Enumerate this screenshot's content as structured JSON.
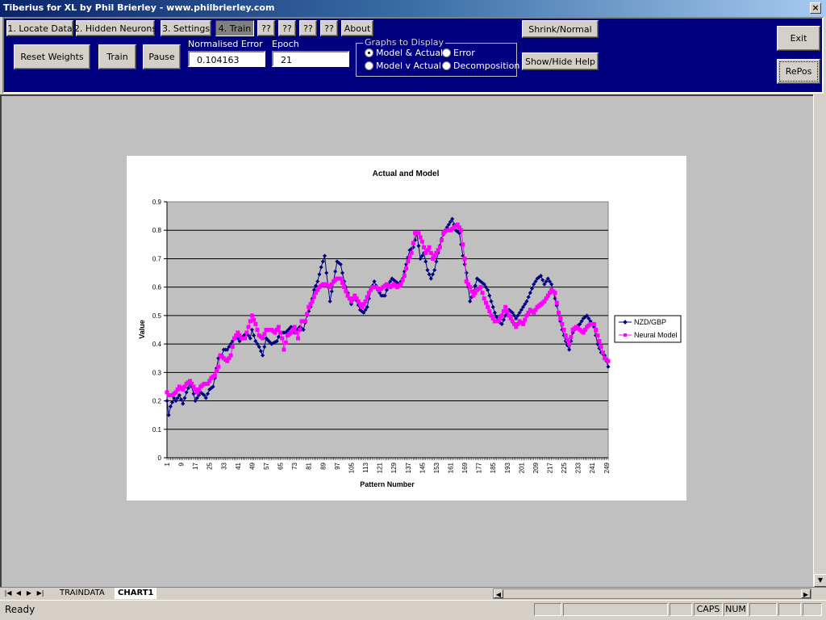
{
  "window": {
    "title": "Tiberius for XL by Phil Brierley - www.philbrierley.com",
    "close_icon": "×"
  },
  "tabs": [
    {
      "label": "1. Locate Data"
    },
    {
      "label": "2. Hidden Neurons"
    },
    {
      "label": "3. Settings"
    },
    {
      "label": "4. Train",
      "active": true
    },
    {
      "label": "??"
    },
    {
      "label": "??"
    },
    {
      "label": "??"
    },
    {
      "label": "??"
    },
    {
      "label": "About"
    }
  ],
  "controls": {
    "reset_weights": "Reset Weights",
    "train": "Train",
    "pause": "Pause",
    "normalised_error_label": "Normalised Error",
    "normalised_error_value": "0.104163",
    "epoch_label": "Epoch",
    "epoch_value": "21",
    "shrink_normal": "Shrink/Normal",
    "show_hide_help": "Show/Hide Help",
    "exit": "Exit",
    "repos": "RePos"
  },
  "graphs_to_display": {
    "legend": "Graphs to Display",
    "options": [
      {
        "label": "Model & Actual",
        "selected": true
      },
      {
        "label": "Error",
        "selected": false
      },
      {
        "label": "Model v Actual",
        "selected": false
      },
      {
        "label": "Decomposition",
        "selected": false
      }
    ]
  },
  "sheet_tabs": [
    {
      "label": "TRAINDATA",
      "active": false
    },
    {
      "label": "CHART1",
      "active": true
    }
  ],
  "status_bar": {
    "status": "Ready",
    "indicators": [
      "CAPS",
      "NUM"
    ]
  },
  "chart_data": {
    "type": "line",
    "title": "Actual and Model",
    "xlabel": "Pattern Number",
    "ylabel": "Value",
    "ylim": [
      0,
      0.9
    ],
    "yticks": [
      "0",
      "0.1",
      "0.2",
      "0.3",
      "0.4",
      "0.5",
      "0.6",
      "0.7",
      "0.8",
      "0.9"
    ],
    "xlim": [
      1,
      250
    ],
    "xticks": [
      "1",
      "9",
      "17",
      "25",
      "33",
      "41",
      "49",
      "57",
      "65",
      "73",
      "81",
      "89",
      "97",
      "105",
      "113",
      "121",
      "129",
      "137",
      "145",
      "153",
      "161",
      "169",
      "177",
      "185",
      "193",
      "201",
      "209",
      "217",
      "225",
      "233",
      "241",
      "249"
    ],
    "grid": true,
    "legend_position": "right",
    "series": [
      {
        "name": "NZD/GBP",
        "color": "#000080",
        "marker": "diamond",
        "points": [
          [
            1,
            0.2
          ],
          [
            2,
            0.15
          ],
          [
            3,
            0.18
          ],
          [
            5,
            0.21
          ],
          [
            6,
            0.2
          ],
          [
            8,
            0.22
          ],
          [
            10,
            0.19
          ],
          [
            12,
            0.23
          ],
          [
            14,
            0.26
          ],
          [
            15,
            0.25
          ],
          [
            17,
            0.2
          ],
          [
            19,
            0.22
          ],
          [
            20,
            0.23
          ],
          [
            22,
            0.22
          ],
          [
            23,
            0.21
          ],
          [
            25,
            0.24
          ],
          [
            27,
            0.25
          ],
          [
            28,
            0.28
          ],
          [
            30,
            0.35
          ],
          [
            32,
            0.36
          ],
          [
            33,
            0.38
          ],
          [
            35,
            0.38
          ],
          [
            37,
            0.4
          ],
          [
            40,
            0.43
          ],
          [
            42,
            0.41
          ],
          [
            43,
            0.42
          ],
          [
            46,
            0.44
          ],
          [
            48,
            0.42
          ],
          [
            49,
            0.45
          ],
          [
            51,
            0.41
          ],
          [
            53,
            0.39
          ],
          [
            55,
            0.36
          ],
          [
            57,
            0.42
          ],
          [
            60,
            0.4
          ],
          [
            63,
            0.41
          ],
          [
            65,
            0.44
          ],
          [
            68,
            0.44
          ],
          [
            71,
            0.46
          ],
          [
            73,
            0.44
          ],
          [
            76,
            0.46
          ],
          [
            78,
            0.45
          ],
          [
            80,
            0.5
          ],
          [
            82,
            0.53
          ],
          [
            84,
            0.59
          ],
          [
            86,
            0.62
          ],
          [
            88,
            0.67
          ],
          [
            90,
            0.71
          ],
          [
            91,
            0.65
          ],
          [
            93,
            0.55
          ],
          [
            95,
            0.62
          ],
          [
            97,
            0.69
          ],
          [
            99,
            0.68
          ],
          [
            101,
            0.62
          ],
          [
            103,
            0.58
          ],
          [
            105,
            0.54
          ],
          [
            107,
            0.57
          ],
          [
            110,
            0.52
          ],
          [
            112,
            0.51
          ],
          [
            114,
            0.53
          ],
          [
            116,
            0.59
          ],
          [
            118,
            0.62
          ],
          [
            120,
            0.59
          ],
          [
            122,
            0.57
          ],
          [
            124,
            0.57
          ],
          [
            126,
            0.61
          ],
          [
            128,
            0.63
          ],
          [
            130,
            0.62
          ],
          [
            132,
            0.61
          ],
          [
            134,
            0.63
          ],
          [
            136,
            0.68
          ],
          [
            138,
            0.73
          ],
          [
            140,
            0.74
          ],
          [
            142,
            0.79
          ],
          [
            144,
            0.7
          ],
          [
            146,
            0.72
          ],
          [
            148,
            0.66
          ],
          [
            150,
            0.63
          ],
          [
            152,
            0.66
          ],
          [
            154,
            0.72
          ],
          [
            156,
            0.77
          ],
          [
            158,
            0.8
          ],
          [
            160,
            0.82
          ],
          [
            162,
            0.84
          ],
          [
            164,
            0.8
          ],
          [
            166,
            0.79
          ],
          [
            168,
            0.71
          ],
          [
            170,
            0.65
          ],
          [
            172,
            0.55
          ],
          [
            174,
            0.58
          ],
          [
            176,
            0.63
          ],
          [
            178,
            0.62
          ],
          [
            180,
            0.61
          ],
          [
            182,
            0.59
          ],
          [
            184,
            0.55
          ],
          [
            186,
            0.51
          ],
          [
            188,
            0.48
          ],
          [
            190,
            0.47
          ],
          [
            192,
            0.5
          ],
          [
            194,
            0.52
          ],
          [
            196,
            0.51
          ],
          [
            198,
            0.49
          ],
          [
            200,
            0.51
          ],
          [
            202,
            0.53
          ],
          [
            204,
            0.55
          ],
          [
            206,
            0.58
          ],
          [
            208,
            0.61
          ],
          [
            210,
            0.63
          ],
          [
            212,
            0.64
          ],
          [
            214,
            0.61
          ],
          [
            216,
            0.63
          ],
          [
            218,
            0.61
          ],
          [
            220,
            0.56
          ],
          [
            222,
            0.51
          ],
          [
            224,
            0.45
          ],
          [
            226,
            0.41
          ],
          [
            228,
            0.38
          ],
          [
            230,
            0.44
          ],
          [
            232,
            0.46
          ],
          [
            234,
            0.47
          ],
          [
            236,
            0.49
          ],
          [
            238,
            0.5
          ],
          [
            240,
            0.48
          ],
          [
            242,
            0.46
          ],
          [
            244,
            0.4
          ],
          [
            246,
            0.37
          ],
          [
            248,
            0.36
          ],
          [
            250,
            0.32
          ]
        ]
      },
      {
        "name": "Neural Model",
        "color": "#ff00ff",
        "marker": "square",
        "points": [
          [
            1,
            0.23
          ],
          [
            2,
            0.22
          ],
          [
            4,
            0.22
          ],
          [
            6,
            0.23
          ],
          [
            8,
            0.25
          ],
          [
            10,
            0.24
          ],
          [
            12,
            0.26
          ],
          [
            14,
            0.27
          ],
          [
            16,
            0.25
          ],
          [
            18,
            0.23
          ],
          [
            20,
            0.25
          ],
          [
            22,
            0.26
          ],
          [
            24,
            0.26
          ],
          [
            26,
            0.28
          ],
          [
            28,
            0.29
          ],
          [
            30,
            0.32
          ],
          [
            31,
            0.36
          ],
          [
            33,
            0.35
          ],
          [
            35,
            0.34
          ],
          [
            37,
            0.36
          ],
          [
            39,
            0.42
          ],
          [
            41,
            0.44
          ],
          [
            43,
            0.42
          ],
          [
            45,
            0.42
          ],
          [
            47,
            0.46
          ],
          [
            49,
            0.5
          ],
          [
            51,
            0.47
          ],
          [
            53,
            0.43
          ],
          [
            55,
            0.42
          ],
          [
            57,
            0.45
          ],
          [
            60,
            0.45
          ],
          [
            62,
            0.44
          ],
          [
            64,
            0.46
          ],
          [
            66,
            0.42
          ],
          [
            67,
            0.38
          ],
          [
            69,
            0.43
          ],
          [
            71,
            0.44
          ],
          [
            73,
            0.46
          ],
          [
            75,
            0.42
          ],
          [
            77,
            0.48
          ],
          [
            79,
            0.48
          ],
          [
            81,
            0.53
          ],
          [
            83,
            0.55
          ],
          [
            85,
            0.58
          ],
          [
            87,
            0.6
          ],
          [
            89,
            0.61
          ],
          [
            91,
            0.61
          ],
          [
            93,
            0.6
          ],
          [
            95,
            0.62
          ],
          [
            97,
            0.63
          ],
          [
            99,
            0.63
          ],
          [
            101,
            0.6
          ],
          [
            103,
            0.57
          ],
          [
            105,
            0.55
          ],
          [
            107,
            0.57
          ],
          [
            109,
            0.55
          ],
          [
            111,
            0.53
          ],
          [
            113,
            0.55
          ],
          [
            115,
            0.58
          ],
          [
            117,
            0.6
          ],
          [
            119,
            0.6
          ],
          [
            121,
            0.59
          ],
          [
            123,
            0.6
          ],
          [
            125,
            0.61
          ],
          [
            127,
            0.6
          ],
          [
            129,
            0.61
          ],
          [
            131,
            0.6
          ],
          [
            133,
            0.61
          ],
          [
            135,
            0.64
          ],
          [
            137,
            0.69
          ],
          [
            139,
            0.72
          ],
          [
            141,
            0.79
          ],
          [
            143,
            0.79
          ],
          [
            145,
            0.76
          ],
          [
            147,
            0.72
          ],
          [
            149,
            0.74
          ],
          [
            151,
            0.7
          ],
          [
            153,
            0.72
          ],
          [
            155,
            0.74
          ],
          [
            157,
            0.79
          ],
          [
            159,
            0.8
          ],
          [
            161,
            0.8
          ],
          [
            163,
            0.81
          ],
          [
            165,
            0.82
          ],
          [
            167,
            0.8
          ],
          [
            169,
            0.7
          ],
          [
            170,
            0.62
          ],
          [
            172,
            0.6
          ],
          [
            174,
            0.57
          ],
          [
            176,
            0.59
          ],
          [
            178,
            0.6
          ],
          [
            180,
            0.56
          ],
          [
            182,
            0.53
          ],
          [
            184,
            0.5
          ],
          [
            186,
            0.48
          ],
          [
            188,
            0.48
          ],
          [
            190,
            0.5
          ],
          [
            192,
            0.53
          ],
          [
            194,
            0.5
          ],
          [
            196,
            0.48
          ],
          [
            198,
            0.46
          ],
          [
            200,
            0.48
          ],
          [
            202,
            0.47
          ],
          [
            204,
            0.5
          ],
          [
            206,
            0.52
          ],
          [
            208,
            0.51
          ],
          [
            210,
            0.53
          ],
          [
            212,
            0.54
          ],
          [
            214,
            0.55
          ],
          [
            216,
            0.57
          ],
          [
            218,
            0.59
          ],
          [
            220,
            0.58
          ],
          [
            222,
            0.51
          ],
          [
            224,
            0.47
          ],
          [
            226,
            0.43
          ],
          [
            228,
            0.4
          ],
          [
            230,
            0.45
          ],
          [
            232,
            0.46
          ],
          [
            234,
            0.45
          ],
          [
            236,
            0.44
          ],
          [
            238,
            0.46
          ],
          [
            240,
            0.47
          ],
          [
            242,
            0.47
          ],
          [
            244,
            0.43
          ],
          [
            246,
            0.39
          ],
          [
            248,
            0.35
          ],
          [
            250,
            0.34
          ]
        ]
      }
    ]
  }
}
